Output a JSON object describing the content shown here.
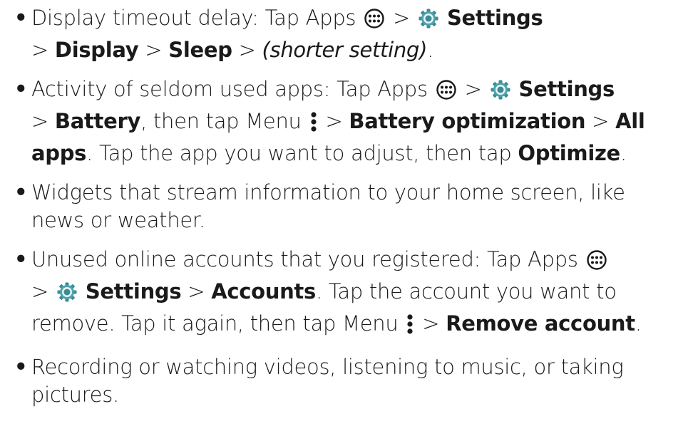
{
  "bullet": "•",
  "items": [
    {
      "parts": [
        {
          "t": "Display timeout delay: Tap Apps "
        },
        {
          "icon": "apps-icon"
        },
        {
          "t": " > "
        },
        {
          "icon": "settings-gear-icon"
        },
        {
          "t": " "
        },
        {
          "b": "Settings"
        },
        {
          "br": true
        },
        {
          "t": "> "
        },
        {
          "b": "Display"
        },
        {
          "t": " > "
        },
        {
          "b": "Sleep"
        },
        {
          "t": " > "
        },
        {
          "i": "(shorter setting)"
        },
        {
          "t": "."
        }
      ]
    },
    {
      "parts": [
        {
          "t": "Activity of seldom used apps: Tap Apps "
        },
        {
          "icon": "apps-icon"
        },
        {
          "t": " > "
        },
        {
          "icon": "settings-gear-icon"
        },
        {
          "t": " "
        },
        {
          "b": "Settings"
        },
        {
          "br": true
        },
        {
          "t": "> "
        },
        {
          "b": "Battery"
        },
        {
          "t": ", then tap Menu "
        },
        {
          "icon": "menu-dots-icon"
        },
        {
          "t": " > "
        },
        {
          "b": "Battery optimization"
        },
        {
          "t": " > "
        },
        {
          "b": "All"
        },
        {
          "br": true
        },
        {
          "b": "apps"
        },
        {
          "t": ". Tap the app you want to adjust, then tap "
        },
        {
          "b": "Optimize"
        },
        {
          "t": "."
        }
      ]
    },
    {
      "parts": [
        {
          "t": "Widgets that stream information to your home screen, like"
        },
        {
          "br": true
        },
        {
          "t": "news or weather."
        }
      ]
    },
    {
      "parts": [
        {
          "t": "Unused online accounts that you registered: Tap Apps "
        },
        {
          "icon": "apps-icon"
        },
        {
          "br": true
        },
        {
          "t": "> "
        },
        {
          "icon": "settings-gear-icon"
        },
        {
          "t": " "
        },
        {
          "b": "Settings"
        },
        {
          "t": " > "
        },
        {
          "b": "Accounts"
        },
        {
          "t": ". Tap the account you want to"
        },
        {
          "br": true
        },
        {
          "t": "remove. Tap it again, then tap Menu "
        },
        {
          "icon": "menu-dots-icon"
        },
        {
          "t": " > "
        },
        {
          "b": "Remove account"
        },
        {
          "t": "."
        }
      ]
    },
    {
      "parts": [
        {
          "t": "Recording or watching videos, listening to music, or taking"
        },
        {
          "br": true
        },
        {
          "t": "pictures."
        }
      ]
    }
  ]
}
